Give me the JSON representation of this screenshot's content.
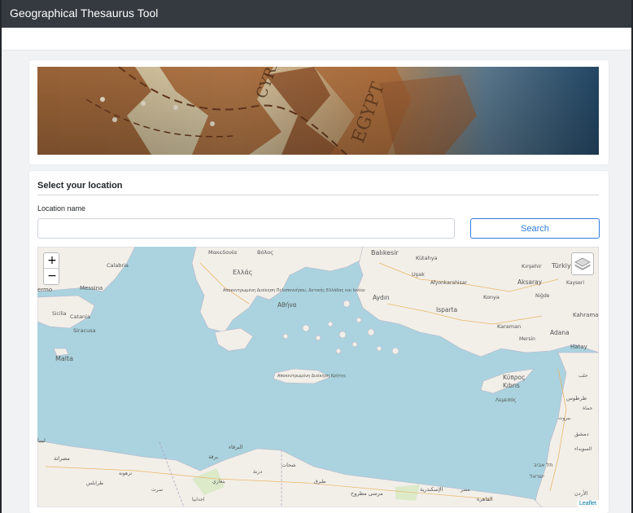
{
  "app": {
    "title": "Geographical Thesaurus Tool"
  },
  "location_card": {
    "title": "Select your location",
    "field_label": "Location name",
    "input_value": "",
    "input_placeholder": "",
    "search_label": "Search"
  },
  "map": {
    "zoom_in": "+",
    "zoom_out": "−",
    "attribution": "Leaflet",
    "labels": {
      "makedonia": "Μακεδονία",
      "volos": "Βόλος",
      "balikesir": "Balıkesir",
      "kutahya": "Kütahya",
      "kirsehir": "Kırşehir",
      "turkiye": "Türkiye",
      "ellas": "Ελλάς",
      "usak": "Uşak",
      "aksaray": "Aksaray",
      "kayseri": "Kayseri",
      "afyon": "Afyonkarahisar",
      "nigde": "Niğde",
      "calabria": "Calabria",
      "ermo": "ermo",
      "messina": "Messina",
      "athina": "Αθήνα",
      "aydin": "Aydın",
      "isparta": "Isparta",
      "konya": "Konya",
      "kahrama": "Kahrama",
      "catania": "Catania",
      "siracusa": "Siracusa",
      "sicilia": "Sicilia",
      "dytiki": "Αποκεντρωμένη Διοίκηση Πελοποννήσου, Δυτικής Ελλάδας και Ιονίου",
      "karaman": "Karaman",
      "adana": "Adana",
      "mersin": "Mersin",
      "hatay": "Hatay",
      "malta": "Malta",
      "kriti": "Αποκεντρωμένη Διοίκηση Κρήτης",
      "kypros": "Κύπρος",
      "kibris": "Kıbrıs",
      "lefkosia": "Λεμεσός",
      "tartous": "طرطوس",
      "dimashq": "دمشق",
      "libya1": "ليبيا",
      "misrata": "مصراتة",
      "barqa": "البرقاء",
      "bernard": "برقة",
      "darnah": "درنة",
      "shahat": "شحات",
      "matruh": "مرسى مطروح",
      "iskandariya": "الإسكندرية",
      "qahira": "القاهرة",
      "urdun": "الأردن",
      "israel": "ישראל",
      "tel_aviv": "תל אביב",
      "suwayda": "السويداء",
      "halab": "حلب",
      "hama": "حماة",
      "beirut": "بيروت",
      "misr": "مصر",
      "tripoli": "طرابلس",
      "trablus": "ترهونة",
      "ghardabiya": "سرت",
      "ajdabiya": "اجدابيا",
      "tobruk": "طبرق",
      "benghazi": "بنغازي"
    }
  }
}
